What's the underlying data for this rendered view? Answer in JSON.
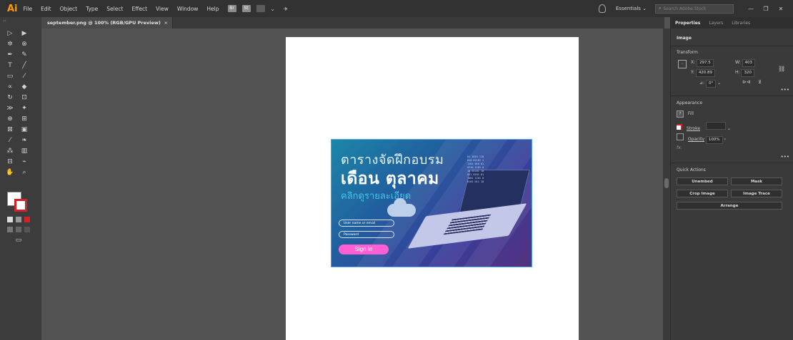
{
  "app": {
    "logo": "Ai"
  },
  "menu": {
    "items": [
      "File",
      "Edit",
      "Object",
      "Type",
      "Select",
      "Effect",
      "View",
      "Window",
      "Help"
    ],
    "br_label": "Br",
    "st_label": "St",
    "workspace": "Essentials",
    "search_placeholder": "Search Adobe Stock"
  },
  "document": {
    "tab_title": "september.png @ 100% (RGB/GPU Preview)",
    "close": "×"
  },
  "toolbar": {
    "collapse": "‹‹"
  },
  "banner": {
    "title_line1": "ตารางจัดฝึกอบรม",
    "title_line2": "เดือน ตุลาคม",
    "subtitle": "คลิกดูรายละเอียด",
    "username_placeholder": "User name or email",
    "password_placeholder": "Password",
    "signin_label": "Sign In",
    "code_text": "01 1010 110\n010 01101 1\n1101 010 01\n0110 1101 0\n10 01101 10\n011 0101 01\n1001 1101 0\n0101 011 10"
  },
  "panel": {
    "tabs": [
      "Properties",
      "Layers",
      "Libraries"
    ],
    "selection_type": "Image",
    "transform": {
      "title": "Transform",
      "x_label": "X:",
      "x_value": "297.5",
      "y_label": "Y:",
      "y_value": "420.89",
      "w_label": "W:",
      "w_value": "403",
      "h_label": "H:",
      "h_value": "320",
      "angle_label": "⊿:",
      "angle_value": "0°"
    },
    "appearance": {
      "title": "Appearance",
      "fill_label": "Fill",
      "stroke_label": "Stroke",
      "opacity_label": "Opacity",
      "opacity_value": "100%",
      "fx_label": "fx."
    },
    "quick_actions": {
      "title": "Quick Actions",
      "unembed": "Unembed",
      "mask": "Mask",
      "crop_image": "Crop Image",
      "image_trace": "Image Trace",
      "arrange": "Arrange"
    }
  }
}
